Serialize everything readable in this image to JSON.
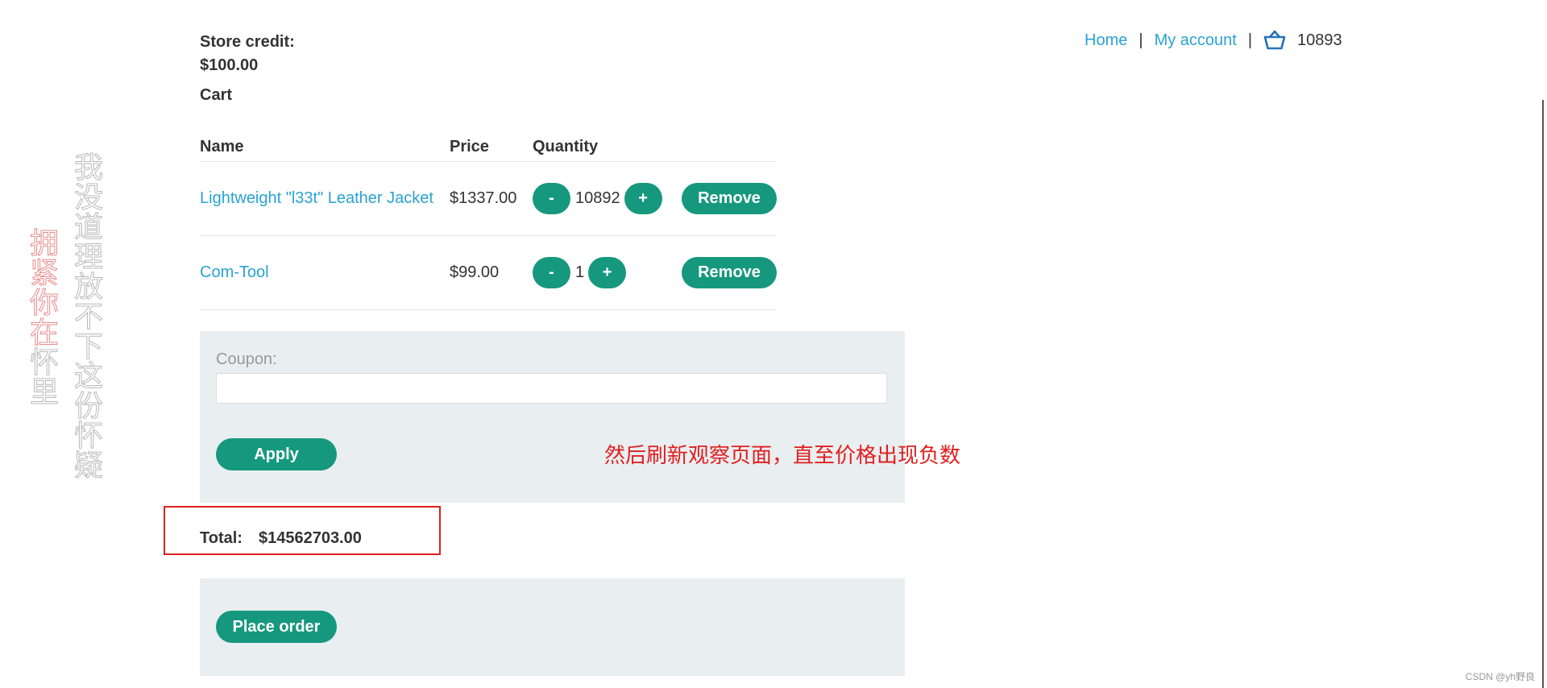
{
  "header": {
    "store_credit_label": "Store credit:",
    "store_credit_value": "$100.00",
    "cart_title": "Cart"
  },
  "nav": {
    "home": "Home",
    "my_account": "My account",
    "separator": "|",
    "cart_icon": "basket-icon",
    "cart_count": "10893"
  },
  "table": {
    "headers": {
      "name": "Name",
      "price": "Price",
      "quantity": "Quantity"
    },
    "rows": [
      {
        "name": "Lightweight \"l33t\" Leather Jacket",
        "price": "$1337.00",
        "quantity": "10892"
      },
      {
        "name": "Com-Tool",
        "price": "$99.00",
        "quantity": "1"
      }
    ],
    "minus_label": "-",
    "plus_label": "+",
    "remove_label": "Remove"
  },
  "coupon": {
    "label": "Coupon:",
    "value": "",
    "apply_label": "Apply"
  },
  "total": {
    "label": "Total:",
    "value": "$14562703.00"
  },
  "order": {
    "place_order_label": "Place order"
  },
  "annotations": {
    "note": "然后刷新观察页面，直至价格出现负数",
    "vertical_left_red": "拥紧你在",
    "vertical_left_gray": "怀里",
    "vertical_right": "我没道理放不下这份怀疑"
  },
  "watermark": "CSDN @yh野良",
  "colors": {
    "accent": "#16987e",
    "link": "#29a3d3",
    "panel": "#e9eef0",
    "annotation": "#e02020"
  }
}
